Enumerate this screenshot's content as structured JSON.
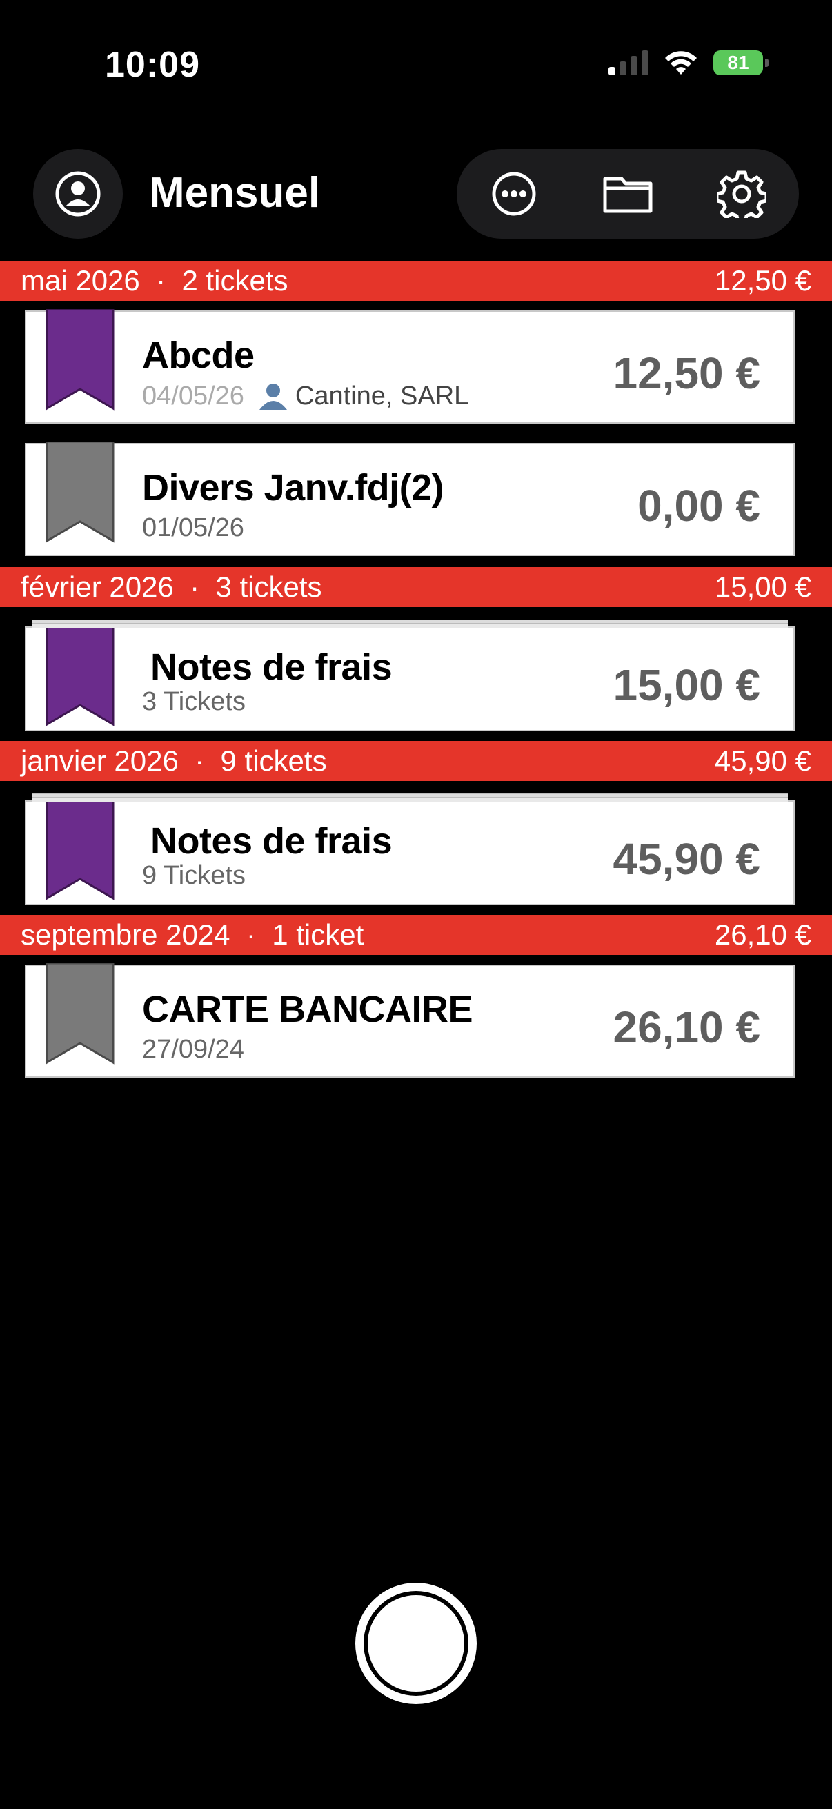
{
  "status": {
    "time": "10:09",
    "battery": "81"
  },
  "header": {
    "title": "Mensuel"
  },
  "sections": [
    {
      "label": "mai 2026",
      "sep": "·",
      "count": "2 tickets",
      "total": "12,50 €",
      "items": [
        {
          "title": "Abcde",
          "date": "04/05/26",
          "person": "Cantine, SARL",
          "amount": "12,50 €",
          "ribbon_color": "#6b2c8c"
        },
        {
          "title": "Divers Janv.fdj(2)",
          "date": "01/05/26",
          "amount": "0,00 €",
          "ribbon_color": "#7a7a7a"
        }
      ]
    },
    {
      "label": "février 2026",
      "sep": "·",
      "count": "3 tickets",
      "total": "15,00 €",
      "items": [
        {
          "title": "Notes de frais",
          "sub": "3 Tickets",
          "amount": "15,00 €",
          "ribbon_color": "#6b2c8c"
        }
      ]
    },
    {
      "label": "janvier 2026",
      "sep": "·",
      "count": "9 tickets",
      "total": "45,90 €",
      "items": [
        {
          "title": "Notes de frais",
          "sub": "9 Tickets",
          "amount": "45,90 €",
          "ribbon_color": "#6b2c8c"
        }
      ]
    },
    {
      "label": "septembre 2024",
      "sep": "·",
      "count": "1 ticket",
      "total": "26,10 €",
      "items": [
        {
          "title": "CARTE BANCAIRE",
          "date": "27/09/24",
          "amount": "26,10 €",
          "ribbon_color": "#7a7a7a"
        }
      ]
    }
  ],
  "icons": {
    "profile": "person-circle-icon",
    "more": "ellipsis-circle-icon",
    "folder": "folder-icon",
    "settings": "gear-icon",
    "capture": "capture-button"
  }
}
